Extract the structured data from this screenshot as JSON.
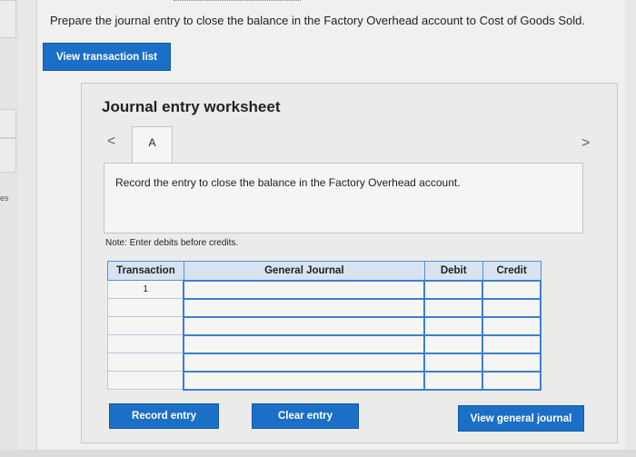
{
  "left_edge_text": "es",
  "question": "Prepare the journal entry to close the balance in the Factory Overhead account to Cost of Goods Sold.",
  "buttons": {
    "view_transaction_list": "View transaction list",
    "record_entry": "Record entry",
    "clear_entry": "Clear entry",
    "view_general_journal": "View general journal"
  },
  "worksheet": {
    "title": "Journal entry worksheet",
    "nav_prev": "<",
    "nav_next": ">",
    "active_tab": "A",
    "instruction": "Record the entry to close the balance in the Factory Overhead account.",
    "note": "Note: Enter debits before credits."
  },
  "journal_table": {
    "headers": [
      "Transaction",
      "General Journal",
      "Debit",
      "Credit"
    ],
    "rows": [
      [
        "1",
        "",
        "",
        ""
      ],
      [
        "",
        "",
        "",
        ""
      ],
      [
        "",
        "",
        "",
        ""
      ],
      [
        "",
        "",
        "",
        ""
      ],
      [
        "",
        "",
        "",
        ""
      ],
      [
        "",
        "",
        "",
        ""
      ]
    ]
  },
  "colors": {
    "button_blue": "#1b6fc7",
    "table_header": "#d7e3f1",
    "cell_border": "#3c7fd4"
  }
}
